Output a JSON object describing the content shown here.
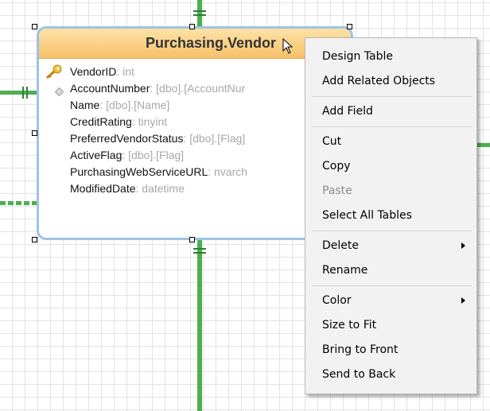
{
  "entity": {
    "title": "Purchasing.Vendor",
    "fields": [
      {
        "name": "VendorID",
        "type": ": int",
        "key": "primary"
      },
      {
        "name": "AccountNumber",
        "type": ": [dbo].[AccountNur",
        "key": "foreign"
      },
      {
        "name": "Name",
        "type": ": [dbo].[Name]",
        "key": ""
      },
      {
        "name": "CreditRating",
        "type": ": tinyint",
        "key": ""
      },
      {
        "name": "PreferredVendorStatus",
        "type": ": [dbo].[Flag]",
        "key": ""
      },
      {
        "name": "ActiveFlag",
        "type": ": [dbo].[Flag]",
        "key": ""
      },
      {
        "name": "PurchasingWebServiceURL",
        "type": ": nvarch",
        "key": ""
      },
      {
        "name": "ModifiedDate",
        "type": ": datetime",
        "key": ""
      }
    ]
  },
  "context_menu": {
    "items": [
      {
        "label": "Design Table"
      },
      {
        "label": "Add Related Objects"
      },
      {
        "label": "Add Field"
      },
      {
        "label": "Cut"
      },
      {
        "label": "Copy"
      },
      {
        "label": "Paste",
        "disabled": true
      },
      {
        "label": "Select All Tables"
      },
      {
        "label": "Delete",
        "submenu": true
      },
      {
        "label": "Rename"
      },
      {
        "label": "Color",
        "submenu": true
      },
      {
        "label": "Size to Fit"
      },
      {
        "label": "Bring to Front"
      },
      {
        "label": "Send to Back"
      }
    ],
    "separators_after": [
      1,
      2,
      6,
      8
    ]
  },
  "colors": {
    "header_gradient_top": "#fde3a7",
    "header_gradient_bottom": "#f6c06a",
    "entity_border": "#9dc3e6",
    "connector": "#4caf50",
    "field_type_text": "#a8a8a8",
    "disabled_menu_text": "#8c8c8c"
  },
  "icons": {
    "primary_key": "key-icon",
    "foreign_key": "diamond-icon",
    "cursor": "cursor-arrow-icon",
    "submenu": "submenu-arrow-icon"
  }
}
